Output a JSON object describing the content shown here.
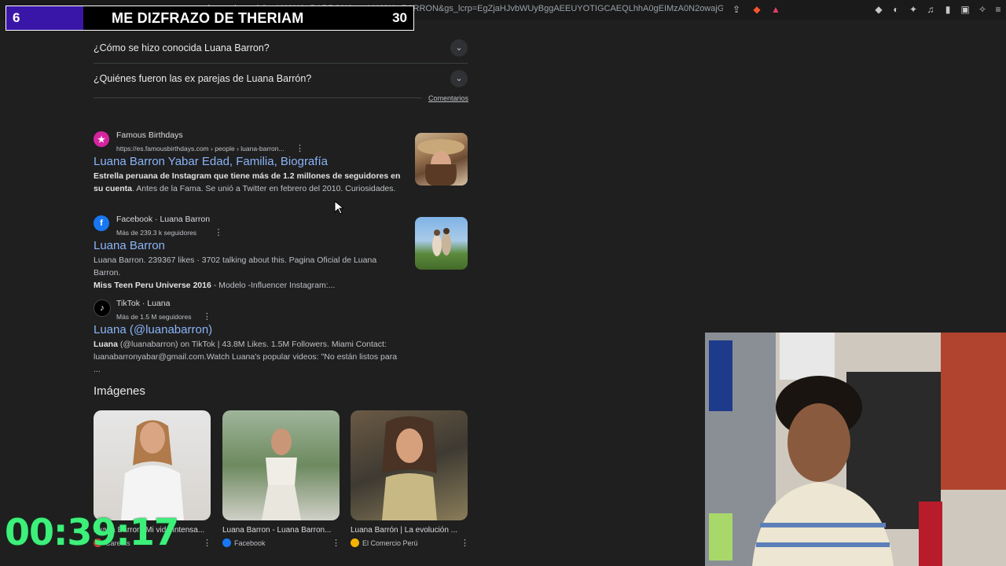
{
  "browser": {
    "url": "google.com/search?q=LUANA+BARRON&oq=LUANA+BARRON&gs_lcrp=EgZjaHJvbWUyBggAEEUYOTIGCAEQLhhA0gEIMzA0N2owajGoAgCwAgA&..."
  },
  "overlay": {
    "left_number": "6",
    "title": "ME DIZFRAZO DE THERIAM",
    "right_number": "30"
  },
  "faq": [
    {
      "question": "¿Cómo se hizo conocida Luana Barron?"
    },
    {
      "question": "¿Quiénes fueron las ex parejas de Luana Barrón?"
    }
  ],
  "feedback_label": "Comentarios",
  "results": [
    {
      "site": "Famous Birthdays",
      "url": "https://es.famousbirthdays.com › people › luana-barron...",
      "title": "Luana Barron Yabar Edad, Familia, Biografía",
      "snippet_bold": "Estrella peruana de Instagram que tiene más de 1.2 millones de seguidores en su cuenta",
      "snippet_rest": ". Antes de la Fama. Se unió a Twitter en febrero del 2010. Curiosidades.",
      "favicon_color": "#d6249f",
      "favicon_icon": "star-icon"
    },
    {
      "site": "Facebook · Luana Barron",
      "url": "Más de 239.3 k seguidores",
      "title": "Luana Barron",
      "snippet_line1": "Luana Barron. 239367 likes · 3702 talking about this. Pagina Oficial de Luana Barron.",
      "snippet_bold": "Miss Teen Peru Universe 2016",
      "snippet_rest": " - Modelo -Influencer Instagram:...",
      "favicon_color": "#1877f2",
      "favicon_icon": "facebook-icon"
    },
    {
      "site": "TikTok · Luana",
      "url": "Más de 1.5 M seguidores",
      "title": "Luana (@luanabarron)",
      "snippet_bold": "Luana",
      "snippet_rest": " (@luanabarron) on TikTok | 43.8M Likes. 1.5M Followers. Miami Contact: luanabarronyabar@gmail.com.Watch Luana's popular videos: \"No están listos para ...",
      "favicon_color": "#000000",
      "favicon_icon": "tiktok-icon"
    }
  ],
  "images_section": {
    "heading": "Imágenes",
    "items": [
      {
        "caption": "Luana Barron: Mi vida intensa...",
        "source": "Caretas",
        "fav_color": "#e53935"
      },
      {
        "caption": "Luana Barron - Luana Barron...",
        "source": "Facebook",
        "fav_color": "#1877f2"
      },
      {
        "caption": "Luana Barrón | La evolución ...",
        "source": "El Comercio Perú",
        "fav_color": "#f4b400"
      }
    ]
  },
  "stream": {
    "timer": "00:39:17"
  }
}
